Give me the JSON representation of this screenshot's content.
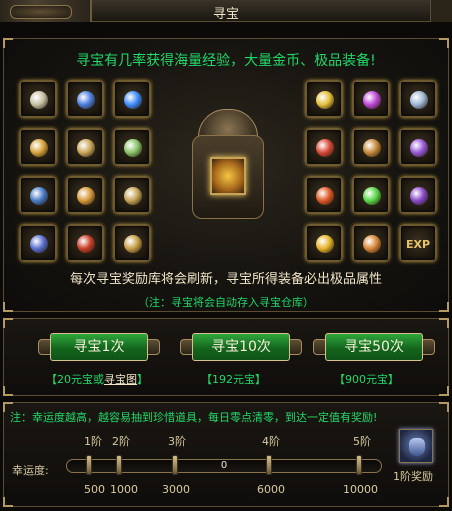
{
  "window": {
    "title": "寻宝"
  },
  "treasure": {
    "headline": "寻宝有几率获得海量经验，大量金币、极品装备!",
    "info": "每次寻宝奖励库将会刷新，寻宝所得装备必出极品属性",
    "note": "（注：寻宝将会自动存入寻宝仓库）",
    "left_items": [
      {
        "icon": "ring-icon",
        "color": "#c9c2a5"
      },
      {
        "icon": "sapphire-ring-icon",
        "color": "#4f7fe0"
      },
      {
        "icon": "blue-gem-icon",
        "color": "#3f8cff"
      },
      {
        "icon": "gold-ring-icon",
        "color": "#d8a53c"
      },
      {
        "icon": "ornate-ring-icon",
        "color": "#c9a85a"
      },
      {
        "icon": "jade-ring-icon",
        "color": "#8bc46a"
      },
      {
        "icon": "bracelet-icon",
        "color": "#4a7cc8"
      },
      {
        "icon": "gold-bracelet-icon",
        "color": "#d69a3a"
      },
      {
        "icon": "glove-icon",
        "color": "#c7a558"
      },
      {
        "icon": "boots-icon",
        "color": "#5a6fd0"
      },
      {
        "icon": "red-boots-icon",
        "color": "#c8402a"
      },
      {
        "icon": "gold-boots-icon",
        "color": "#c9a04a"
      }
    ],
    "right_items": [
      {
        "icon": "gold-orb-icon",
        "color": "#e6c03c"
      },
      {
        "icon": "purple-orb-icon",
        "color": "#c04ad8"
      },
      {
        "icon": "silver-orb-icon",
        "color": "#9fb6d6"
      },
      {
        "icon": "red-amulet-icon",
        "color": "#d84a3a"
      },
      {
        "icon": "root-icon",
        "color": "#c58a3a"
      },
      {
        "icon": "purple-crystal-icon",
        "color": "#9a5ad8"
      },
      {
        "icon": "red-orb-icon",
        "color": "#e05a28"
      },
      {
        "icon": "green-orb-icon",
        "color": "#5ad84a"
      },
      {
        "icon": "purple-claw-icon",
        "color": "#8a4ac8"
      },
      {
        "icon": "gold-box-icon",
        "color": "#e6b42c"
      },
      {
        "icon": "scroll-icon",
        "color": "#d8883a"
      },
      {
        "icon": "exp-icon",
        "color": "#e6c36a",
        "label": "EXP"
      }
    ]
  },
  "buttons": [
    {
      "label": "寻宝1次"
    },
    {
      "label": "寻宝10次"
    },
    {
      "label": "寻宝50次"
    }
  ],
  "costs": {
    "c1_prefix": "【20元宝或",
    "c1_link": "寻宝图",
    "c1_suffix": "】",
    "c2": "【192元宝】",
    "c3": "【900元宝】"
  },
  "luck": {
    "note": "注：幸运度越高，越容易抽到珍惜道具，每日零点清零，到达一定值有奖励!",
    "label": "幸运度:",
    "value": "0",
    "fill_fraction": 0,
    "tiers": [
      {
        "name": "1阶",
        "value": "500"
      },
      {
        "name": "2阶",
        "value": "1000"
      },
      {
        "name": "3阶",
        "value": "3000"
      },
      {
        "name": "4阶",
        "value": "6000"
      },
      {
        "name": "5阶",
        "value": "10000"
      }
    ],
    "reward_label": "1阶奖励"
  }
}
